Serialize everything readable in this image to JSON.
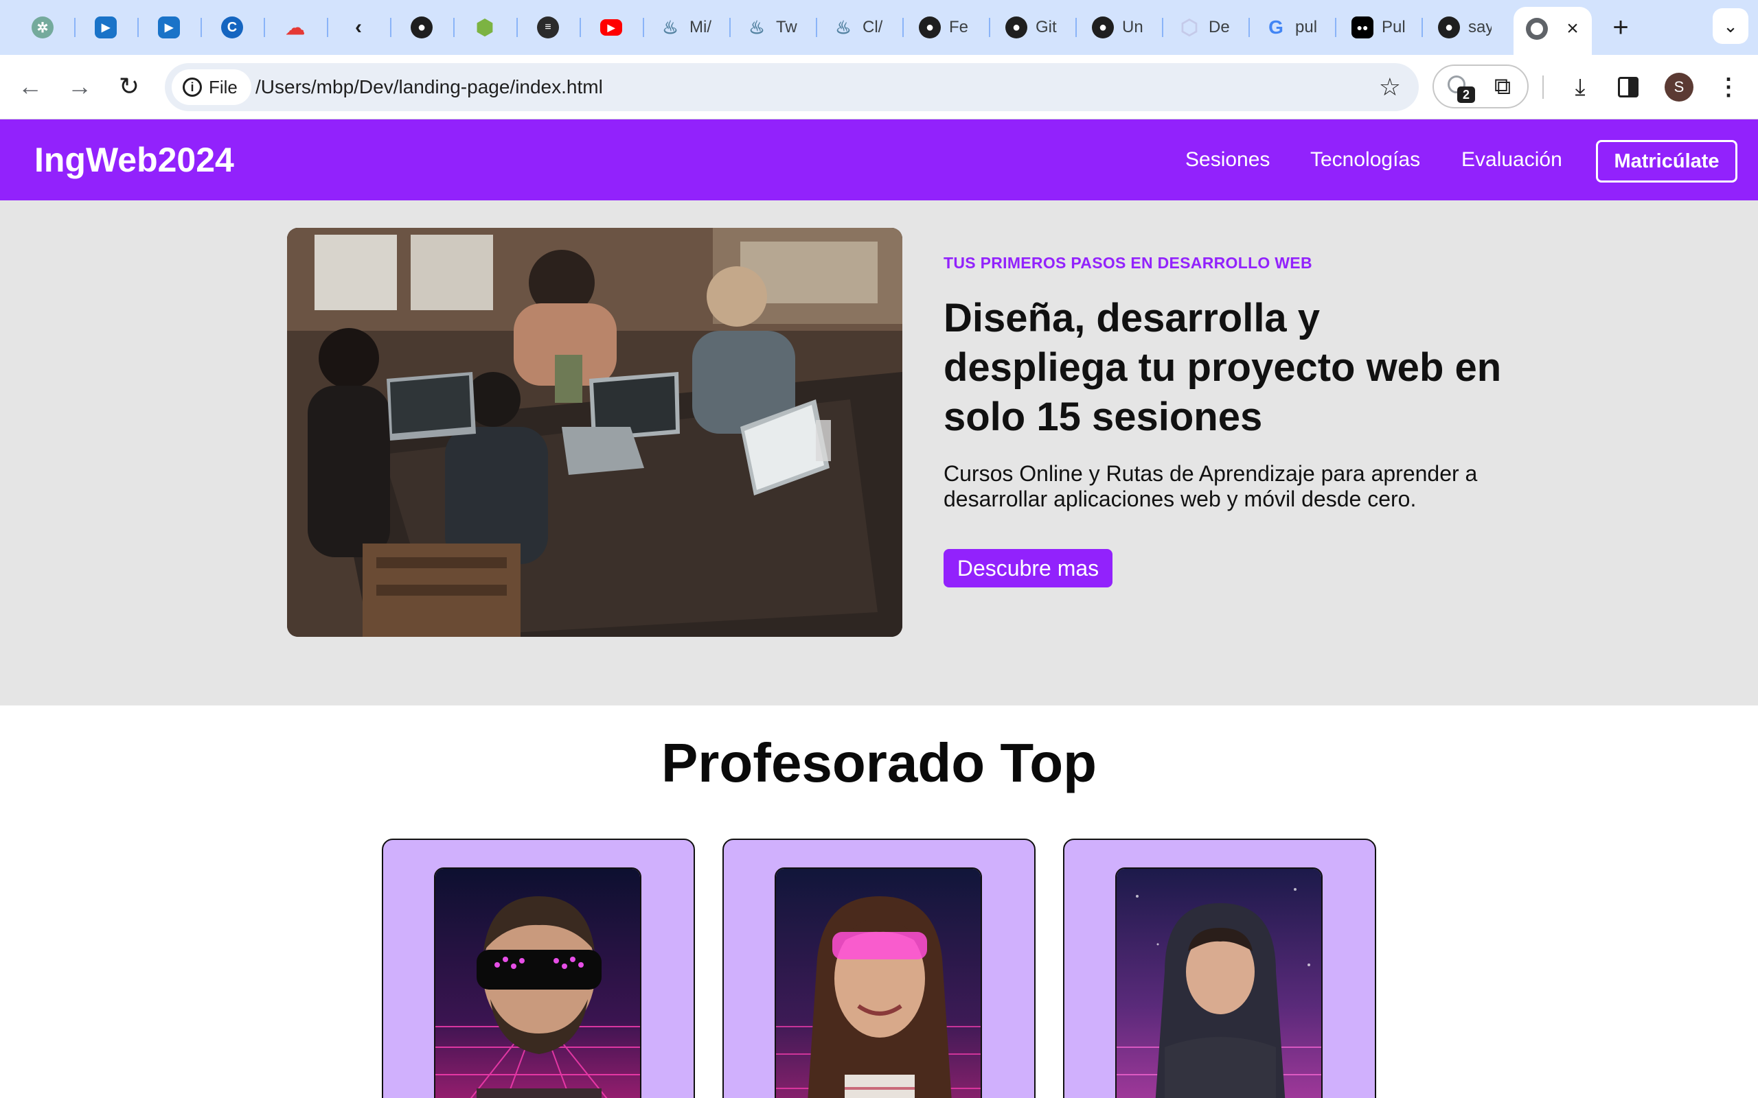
{
  "browser": {
    "tabs": [
      {
        "icon": "chatgpt-icon",
        "title": "",
        "color": "#74aa9c"
      },
      {
        "icon": "video-icon",
        "title": "",
        "color": "#1a73c8"
      },
      {
        "icon": "video-icon",
        "title": "",
        "color": "#1a73c8"
      },
      {
        "icon": "c-logo-icon",
        "title": "",
        "color": "#1565c0"
      },
      {
        "icon": "cloud-icon",
        "title": "",
        "color": "#e53935"
      },
      {
        "icon": "leetcode-icon",
        "title": "",
        "color": "#f89f1b"
      },
      {
        "icon": "github-icon",
        "title": "",
        "color": "#1f1f1f"
      },
      {
        "icon": "cube-icon",
        "title": "",
        "color": "#7cb342"
      },
      {
        "icon": "notes-icon",
        "title": "",
        "color": "#2b2b2b"
      },
      {
        "icon": "youtube-icon",
        "title": "",
        "color": "#ff0000"
      },
      {
        "icon": "java-icon",
        "title": "Mi/",
        "color": "#5382a1"
      },
      {
        "icon": "java-icon",
        "title": "Tw",
        "color": "#5382a1"
      },
      {
        "icon": "java-icon",
        "title": "Cl/",
        "color": "#5382a1"
      },
      {
        "icon": "github-icon",
        "title": "Fe",
        "color": "#1f1f1f"
      },
      {
        "icon": "github-icon",
        "title": "Git",
        "color": "#1f1f1f"
      },
      {
        "icon": "github-icon",
        "title": "Un",
        "color": "#1f1f1f"
      },
      {
        "icon": "hexagon-icon",
        "title": "De",
        "color": "#c5cae9"
      },
      {
        "icon": "google-icon",
        "title": "pul",
        "color": "#4285f4"
      },
      {
        "icon": "medium-icon",
        "title": "Pul",
        "color": "#000000"
      },
      {
        "icon": "github-icon",
        "title": "say",
        "color": "#1f1f1f"
      }
    ],
    "chip_label": "File",
    "url": "/Users/mbp/Dev/landing-page/index.html",
    "extension_badge": "2",
    "avatar_letter": "S"
  },
  "site": {
    "logo": "IngWeb2024",
    "nav": [
      "Sesiones",
      "Tecnologías",
      "Evaluación"
    ],
    "enroll": "Matricúlate",
    "accent": "#9222fc"
  },
  "hero": {
    "eyebrow": "TUS PRIMEROS PASOS EN DESARROLLO WEB",
    "headline": "Diseña, desarrolla y despliega tu proyecto web en solo 15 sesiones",
    "lead": "Cursos Online y Rutas de Aprendizaje para aprender a desarrollar aplicaciones web y móvil desde cero.",
    "cta": "Descubre mas"
  },
  "teachers": {
    "title": "Profesorado Top",
    "card_color": "#d0b0fd"
  }
}
